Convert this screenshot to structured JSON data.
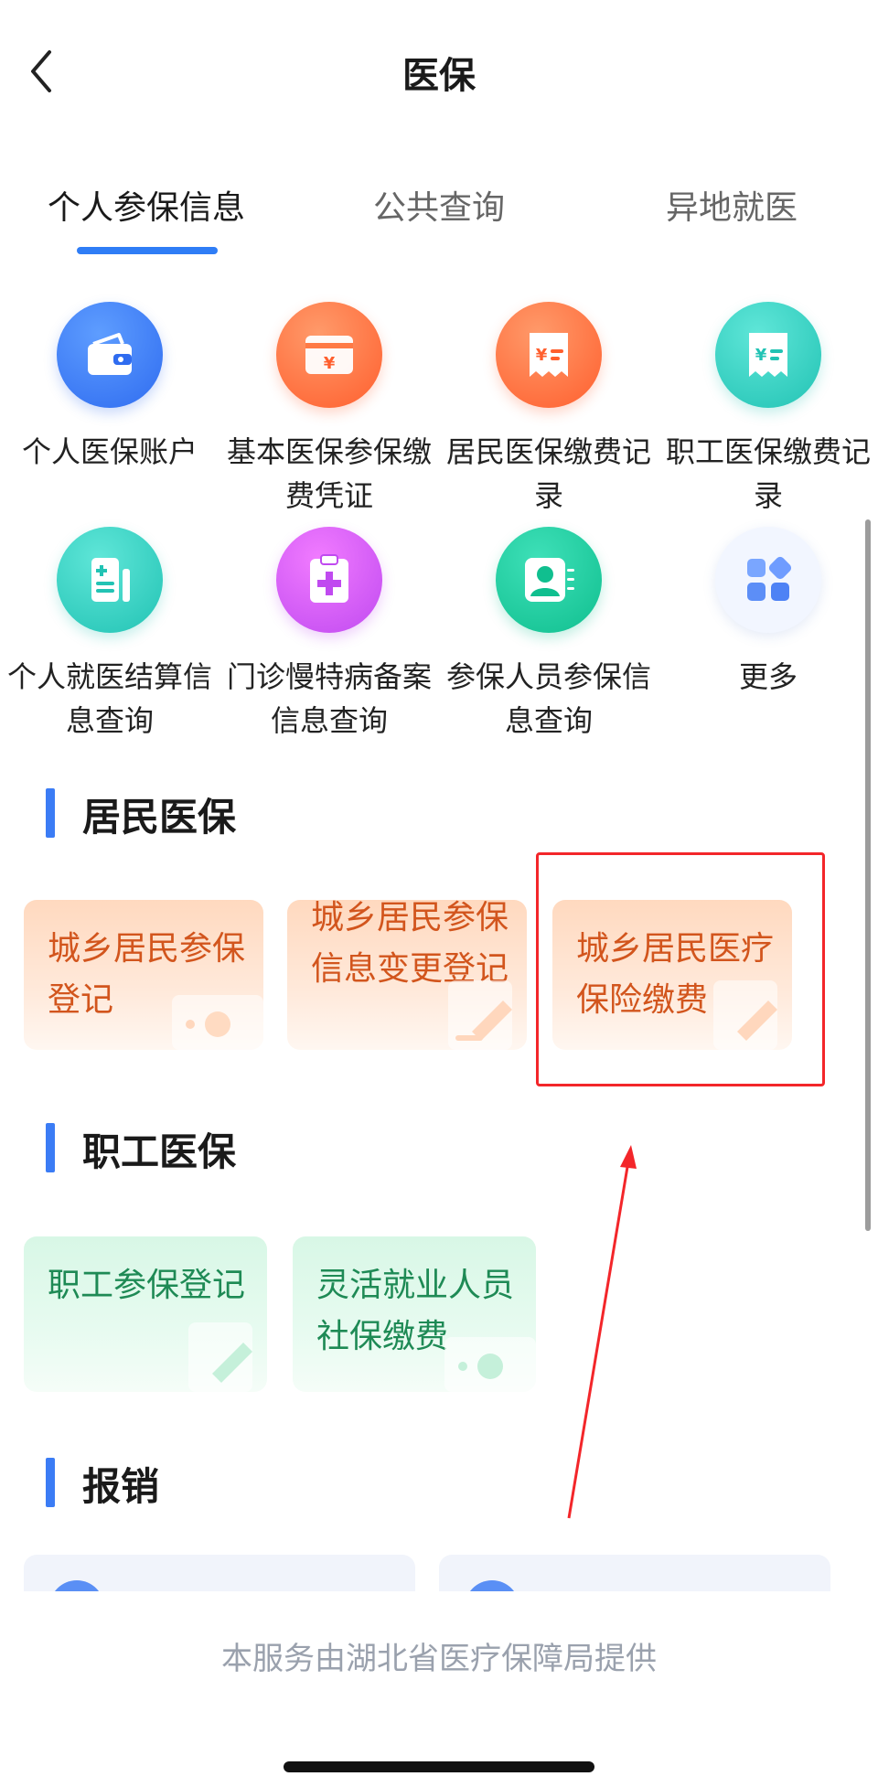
{
  "header": {
    "title": "医保"
  },
  "tabs": [
    {
      "label": "个人参保信息"
    },
    {
      "label": "公共查询"
    },
    {
      "label": "异地就医"
    }
  ],
  "grid": [
    {
      "label": "个人医保账户",
      "icon": "wallet-icon"
    },
    {
      "label": "基本医保参保缴费凭证",
      "icon": "card-icon"
    },
    {
      "label": "居民医保缴费记录",
      "icon": "receipt-icon"
    },
    {
      "label": "职工医保缴费记录",
      "icon": "receipt-icon"
    },
    {
      "label": "个人就医结算信息查询",
      "icon": "document-icon"
    },
    {
      "label": "门诊慢特病备案信息查询",
      "icon": "medical-cross-icon"
    },
    {
      "label": "参保人员参保信息查询",
      "icon": "person-icon"
    },
    {
      "label": "更多",
      "icon": "grid-more-icon"
    }
  ],
  "sections": {
    "resident": {
      "title": "居民医保",
      "cards": [
        {
          "label": "城乡居民参保登记"
        },
        {
          "label": "城乡居民参保信息变更登记"
        },
        {
          "label": "城乡居民医疗保险缴费"
        }
      ]
    },
    "employee": {
      "title": "职工医保",
      "cards": [
        {
          "label": "职工参保登记"
        },
        {
          "label": "灵活就业人员社保缴费"
        }
      ]
    },
    "reimburse": {
      "title": "报销"
    }
  },
  "footer": {
    "text": "本服务由湖北省医疗保障局提供"
  },
  "colors": {
    "accent": "#3b7cf5",
    "highlight": "#f3262a",
    "orange_text": "#d2551d",
    "green_text": "#1e8a55"
  }
}
